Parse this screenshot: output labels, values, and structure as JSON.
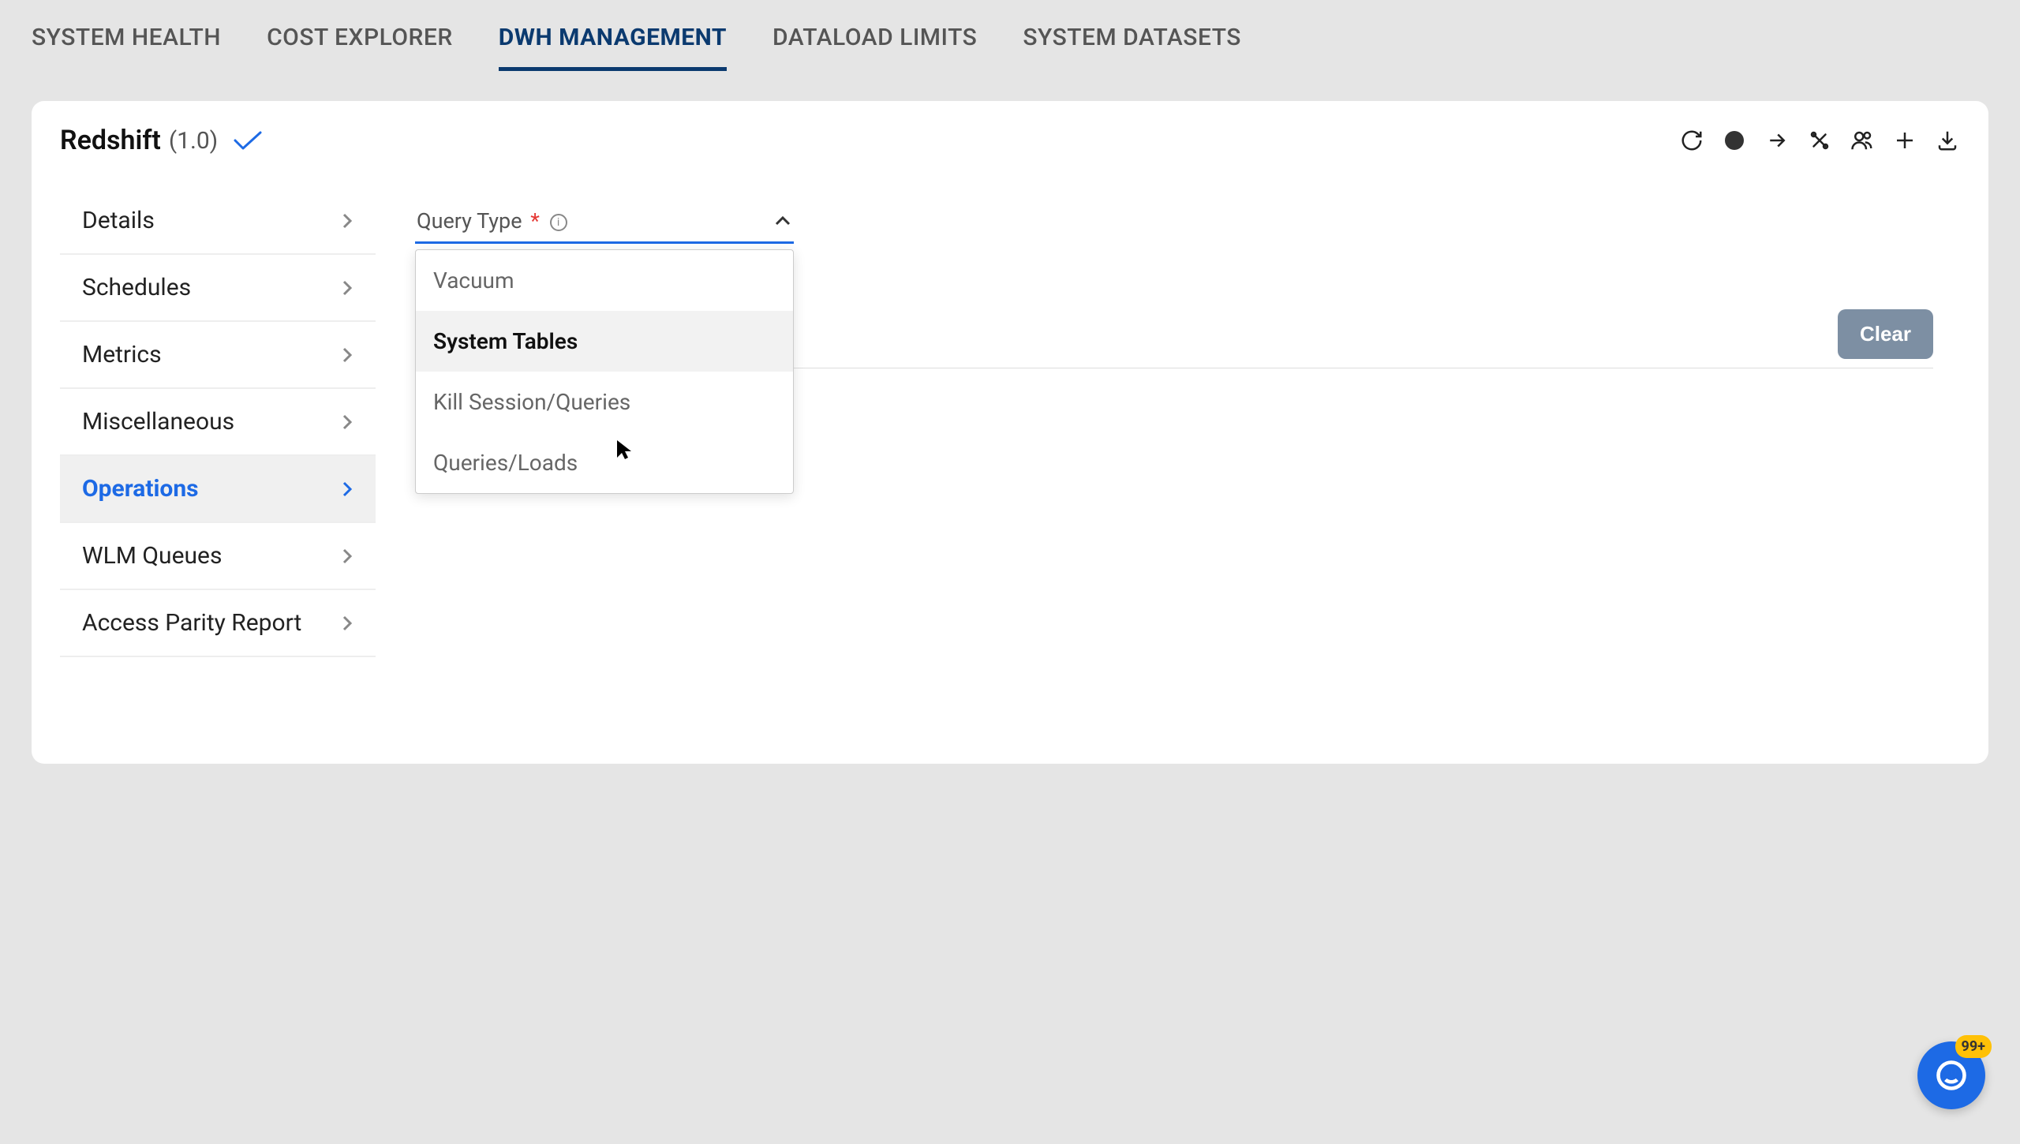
{
  "nav": {
    "tabs": [
      {
        "label": "SYSTEM HEALTH",
        "active": false
      },
      {
        "label": "COST EXPLORER",
        "active": false
      },
      {
        "label": "DWH MANAGEMENT",
        "active": true
      },
      {
        "label": "DATALOAD LIMITS",
        "active": false
      },
      {
        "label": "SYSTEM DATASETS",
        "active": false
      }
    ]
  },
  "header": {
    "title": "Redshift",
    "version": "(1.0)",
    "status_color": "#333333"
  },
  "sidebar": {
    "items": [
      {
        "label": "Details",
        "active": false
      },
      {
        "label": "Schedules",
        "active": false
      },
      {
        "label": "Metrics",
        "active": false
      },
      {
        "label": "Miscellaneous",
        "active": false
      },
      {
        "label": "Operations",
        "active": true
      },
      {
        "label": "WLM Queues",
        "active": false
      },
      {
        "label": "Access Parity Report",
        "active": false
      }
    ]
  },
  "content": {
    "query_type_label": "Query Type",
    "required_marker": "*",
    "dropdown_open": true,
    "dropdown_options": [
      {
        "label": "Vacuum",
        "highlight": false
      },
      {
        "label": "System Tables",
        "highlight": true
      },
      {
        "label": "Kill Session/Queries",
        "highlight": false
      },
      {
        "label": "Queries/Loads",
        "highlight": false
      }
    ],
    "clear_button_label": "Clear"
  },
  "fab": {
    "badge": "99+"
  },
  "colors": {
    "page_bg": "#E5E5E5",
    "accent_navy": "#0B3A6F",
    "accent_blue": "#1D6AE5",
    "clear_btn": "#7D8FA3",
    "badge": "#FFC107"
  }
}
